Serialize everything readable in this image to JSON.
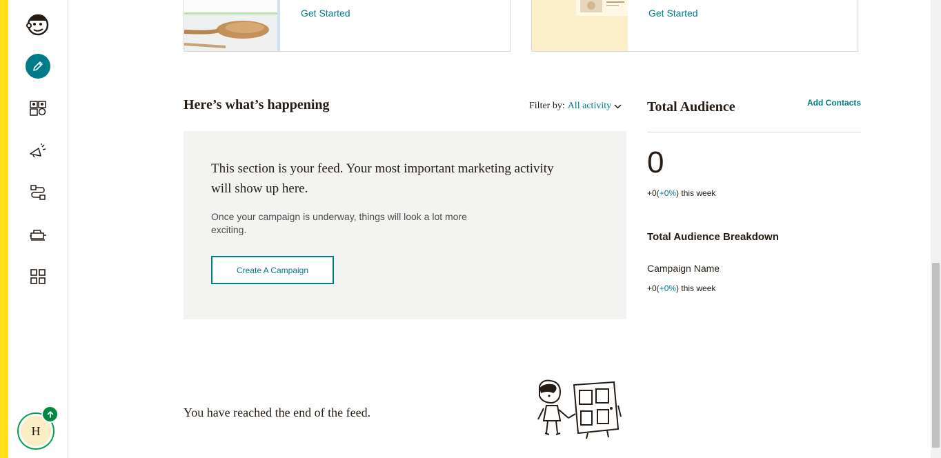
{
  "sidebar": {
    "logo_icon": "freddie-logo-icon",
    "items": [
      {
        "name": "create-icon",
        "active": true
      },
      {
        "name": "audience-icon",
        "active": false
      },
      {
        "name": "campaigns-icon",
        "active": false
      },
      {
        "name": "automations-icon",
        "active": false
      },
      {
        "name": "website-icon",
        "active": false
      },
      {
        "name": "integrations-icon",
        "active": false
      }
    ],
    "avatar_initial": "H"
  },
  "cards": [
    {
      "link": "Get Started"
    },
    {
      "link": "Get Started"
    }
  ],
  "feed": {
    "title": "Here’s what’s happening",
    "filter_label": "Filter by:",
    "filter_value": "All activity",
    "heading": "This section is your feed. Your most important marketing activity will show up here.",
    "subtext": "Once your campaign is underway, things will look a lot more exciting.",
    "button": "Create A Campaign",
    "end_text": "You have reached the end of the feed."
  },
  "audience": {
    "title": "Total Audience",
    "add_contacts": "Add Contacts",
    "count": "0",
    "week_prefix": "+0(",
    "week_pct": "+0%",
    "week_suffix": ") this week",
    "breakdown_title": "Total Audience Breakdown",
    "campaign_name": "Campaign Name",
    "breakdown_prefix": "+0(",
    "breakdown_pct": "+0%",
    "breakdown_suffix": ") this week"
  },
  "colors": {
    "accent": "#007c89",
    "brand_yellow": "#ffe01b",
    "success": "#00893e",
    "feed_bg": "#f3f3f1"
  }
}
